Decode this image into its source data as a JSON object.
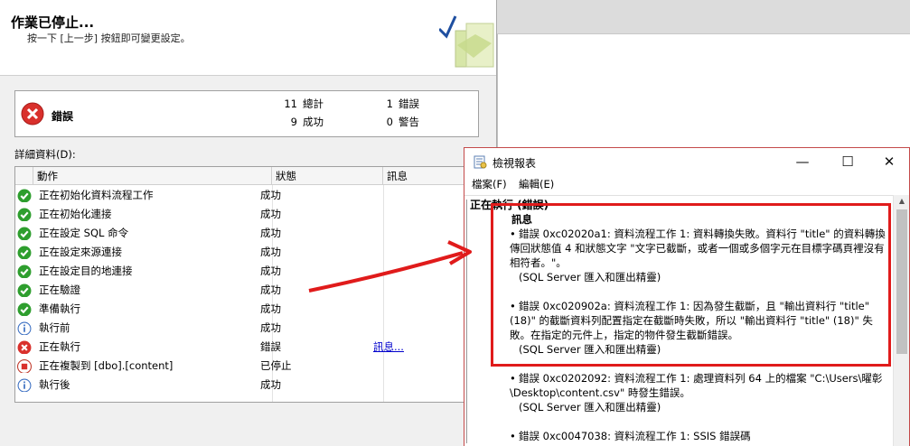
{
  "wizard": {
    "title": "作業已停止...",
    "subtitle": "按一下 [上一步] 按鈕即可變更設定。",
    "summary": {
      "status": "錯誤",
      "total_count": "11",
      "total_label": "總計",
      "success_count": "9",
      "success_label": "成功",
      "error_count": "1",
      "error_label": "錯誤",
      "warning_count": "0",
      "warning_label": "警告"
    },
    "details_label": "詳細資料(D):",
    "columns": {
      "action": "動作",
      "status": "狀態",
      "message": "訊息"
    },
    "rows": [
      {
        "icon": "success-icon",
        "action": "正在初始化資料流程工作",
        "status": "成功",
        "message": ""
      },
      {
        "icon": "success-icon",
        "action": "正在初始化連接",
        "status": "成功",
        "message": ""
      },
      {
        "icon": "success-icon",
        "action": "正在設定 SQL 命令",
        "status": "成功",
        "message": ""
      },
      {
        "icon": "success-icon",
        "action": "正在設定來源連接",
        "status": "成功",
        "message": ""
      },
      {
        "icon": "success-icon",
        "action": "正在設定目的地連接",
        "status": "成功",
        "message": ""
      },
      {
        "icon": "success-icon",
        "action": "正在驗證",
        "status": "成功",
        "message": ""
      },
      {
        "icon": "success-icon",
        "action": "準備執行",
        "status": "成功",
        "message": ""
      },
      {
        "icon": "info-icon",
        "action": "執行前",
        "status": "成功",
        "message": ""
      },
      {
        "icon": "error-icon",
        "action": "正在執行",
        "status": "錯誤",
        "message": "訊息..."
      },
      {
        "icon": "stop-icon",
        "action": "正在複製到 [dbo].[content]",
        "status": "已停止",
        "message": ""
      },
      {
        "icon": "info-icon",
        "action": "執行後",
        "status": "成功",
        "message": ""
      }
    ]
  },
  "report": {
    "title": "檢視報表",
    "menu": {
      "file": "檔案(F)",
      "edit": "編輯(E)"
    },
    "section": "正在執行 (錯誤)",
    "heading": "訊息",
    "errors": [
      {
        "text": "錯誤 0xc02020a1: 資料流程工作 1: 資料轉換失敗。資料行 \"title\" 的資料轉換傳回狀態值 4 和狀態文字 \"文字已截斷，或者一個或多個字元在目標字碼頁裡沒有相符者。\"。",
        "source": "(SQL Server 匯入和匯出精靈)"
      },
      {
        "text": "錯誤 0xc020902a: 資料流程工作 1: 因為發生截斷，且 \"輸出資料行 \"title\" (18)\" 的截斷資料列配置指定在截斷時失敗，所以 \"輸出資料行 \"title\" (18)\" 失敗。在指定的元件上，指定的物件發生截斷錯誤。",
        "source": "(SQL Server 匯入和匯出精靈)"
      },
      {
        "text": "錯誤 0xc0202092: 資料流程工作 1: 處理資料列 64 上的檔案 \"C:\\Users\\曜彰\\Desktop\\content.csv\" 時發生錯誤。",
        "source": "(SQL Server 匯入和匯出精靈)"
      },
      {
        "text": "錯誤 0xc0047038: 資料流程工作 1: SSIS 錯誤碼",
        "source": ""
      }
    ]
  },
  "colors": {
    "accent_red": "#e01b1b",
    "success_green": "#2e9e2e",
    "error_red": "#d9302c",
    "link_blue": "#0000cc"
  }
}
